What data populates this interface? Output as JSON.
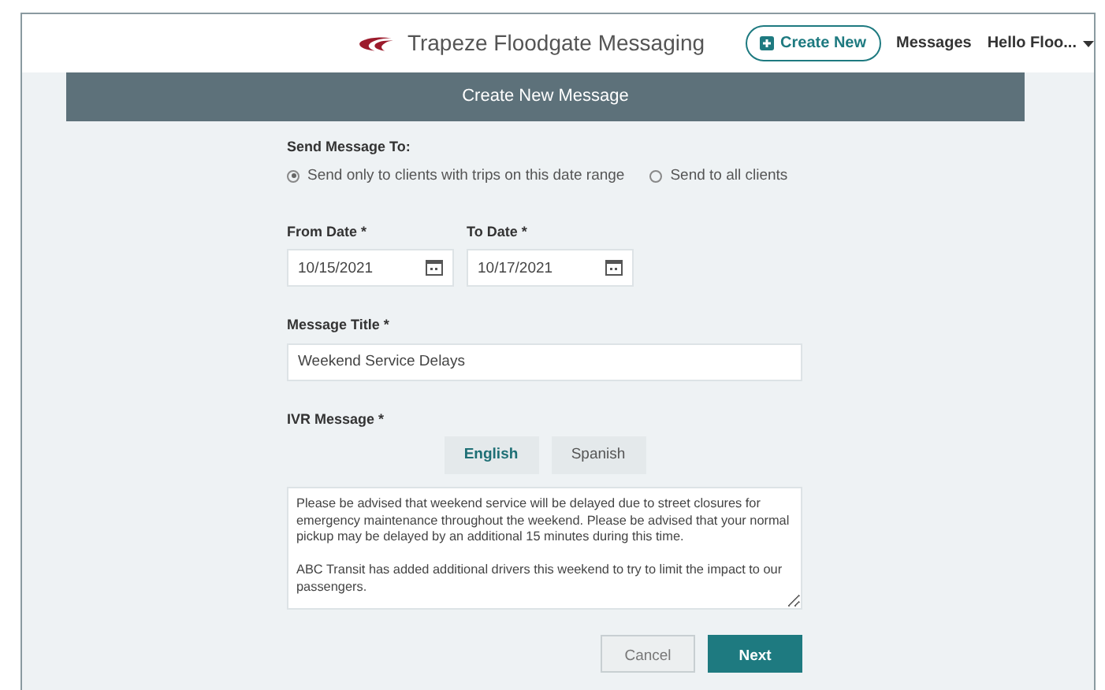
{
  "header": {
    "app_name": "Trapeze Floodgate Messaging",
    "create_button": "Create New",
    "messages_link": "Messages",
    "user_menu": "Hello Floo..."
  },
  "page_title": "Create New Message",
  "send_to": {
    "label": "Send Message To:",
    "options": [
      {
        "label": "Send only to clients with trips on this date range",
        "selected": true
      },
      {
        "label": "Send to all clients",
        "selected": false
      }
    ]
  },
  "from_date": {
    "label": "From Date *",
    "value": "10/15/2021"
  },
  "to_date": {
    "label": "To Date *",
    "value": "10/17/2021"
  },
  "message_title": {
    "label": "Message Title *",
    "value": "Weekend Service Delays"
  },
  "ivr_message": {
    "label": "IVR Message *",
    "tabs": [
      {
        "label": "English",
        "selected": true
      },
      {
        "label": "Spanish",
        "selected": false
      }
    ],
    "text": "Please be advised that weekend service will be delayed due to street closures for emergency maintenance throughout the weekend. Please be advised that your normal pickup may be delayed by an additional 15 minutes during this time.\n\nABC Transit has added additional drivers this weekend to try to limit the impact to our passengers."
  },
  "buttons": [
    {
      "label": "Cancel",
      "kind": "secondary"
    },
    {
      "label": "Next",
      "kind": "primary"
    }
  ]
}
